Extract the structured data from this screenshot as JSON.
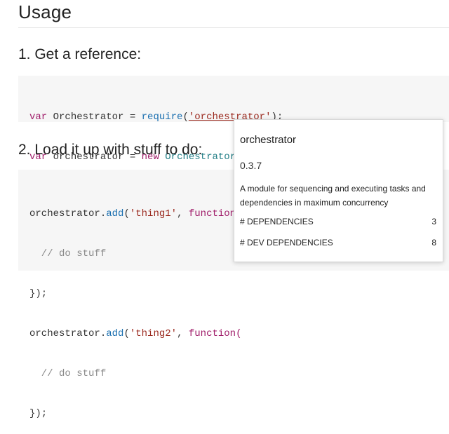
{
  "page": {
    "heading": "Usage",
    "step1": "1. Get a reference:",
    "step2": "2. Load it up with stuff to do:"
  },
  "code1": {
    "l1": {
      "kw": "var",
      "a": " Orchestrator = ",
      "fn": "require",
      "b": "(",
      "str": "'orchestrator'",
      "c": ");"
    },
    "l2": {
      "kw": "var",
      "a": " orchestrator = ",
      "kw2": "new",
      "b": " ",
      "cls": "Orchestrator",
      "c": "();"
    }
  },
  "code2": {
    "l1": {
      "a": "orchestrator.",
      "fn": "add",
      "b": "(",
      "str": "'thing1'",
      "c": ", ",
      "kw": "function("
    },
    "l2": {
      "cmt": "  // do stuff"
    },
    "l3": {
      "a": "});"
    },
    "l4": {
      "a": "orchestrator.",
      "fn": "add",
      "b": "(",
      "str": "'thing2'",
      "c": ", ",
      "kw": "function("
    },
    "l5": {
      "cmt": "  // do stuff"
    },
    "l6": {
      "a": "});"
    }
  },
  "popover": {
    "name": "orchestrator",
    "version": "0.3.7",
    "description": "A module for sequencing and executing tasks and dependencies in maximum concurrency",
    "dependencies_label": "# DEPENDENCIES",
    "dependencies_count": "3",
    "dev_dependencies_label": "# DEV DEPENDENCIES",
    "dev_dependencies_count": "8"
  }
}
